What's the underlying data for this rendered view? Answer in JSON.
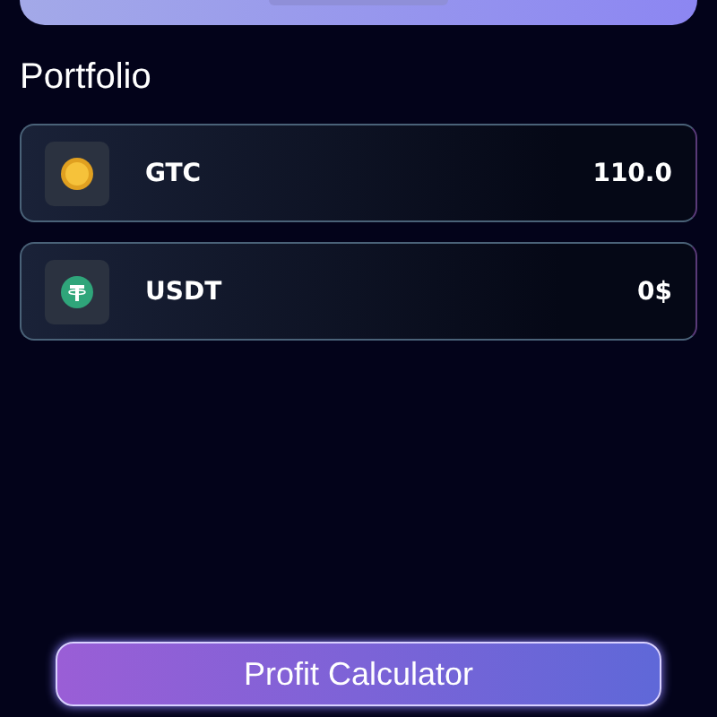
{
  "title": "Portfolio",
  "assets": [
    {
      "symbol": "GTC",
      "amount": "110.0",
      "kind": "coin"
    },
    {
      "symbol": "USDT",
      "amount": "0$",
      "kind": "tether"
    }
  ],
  "button": "Profit Calculator"
}
